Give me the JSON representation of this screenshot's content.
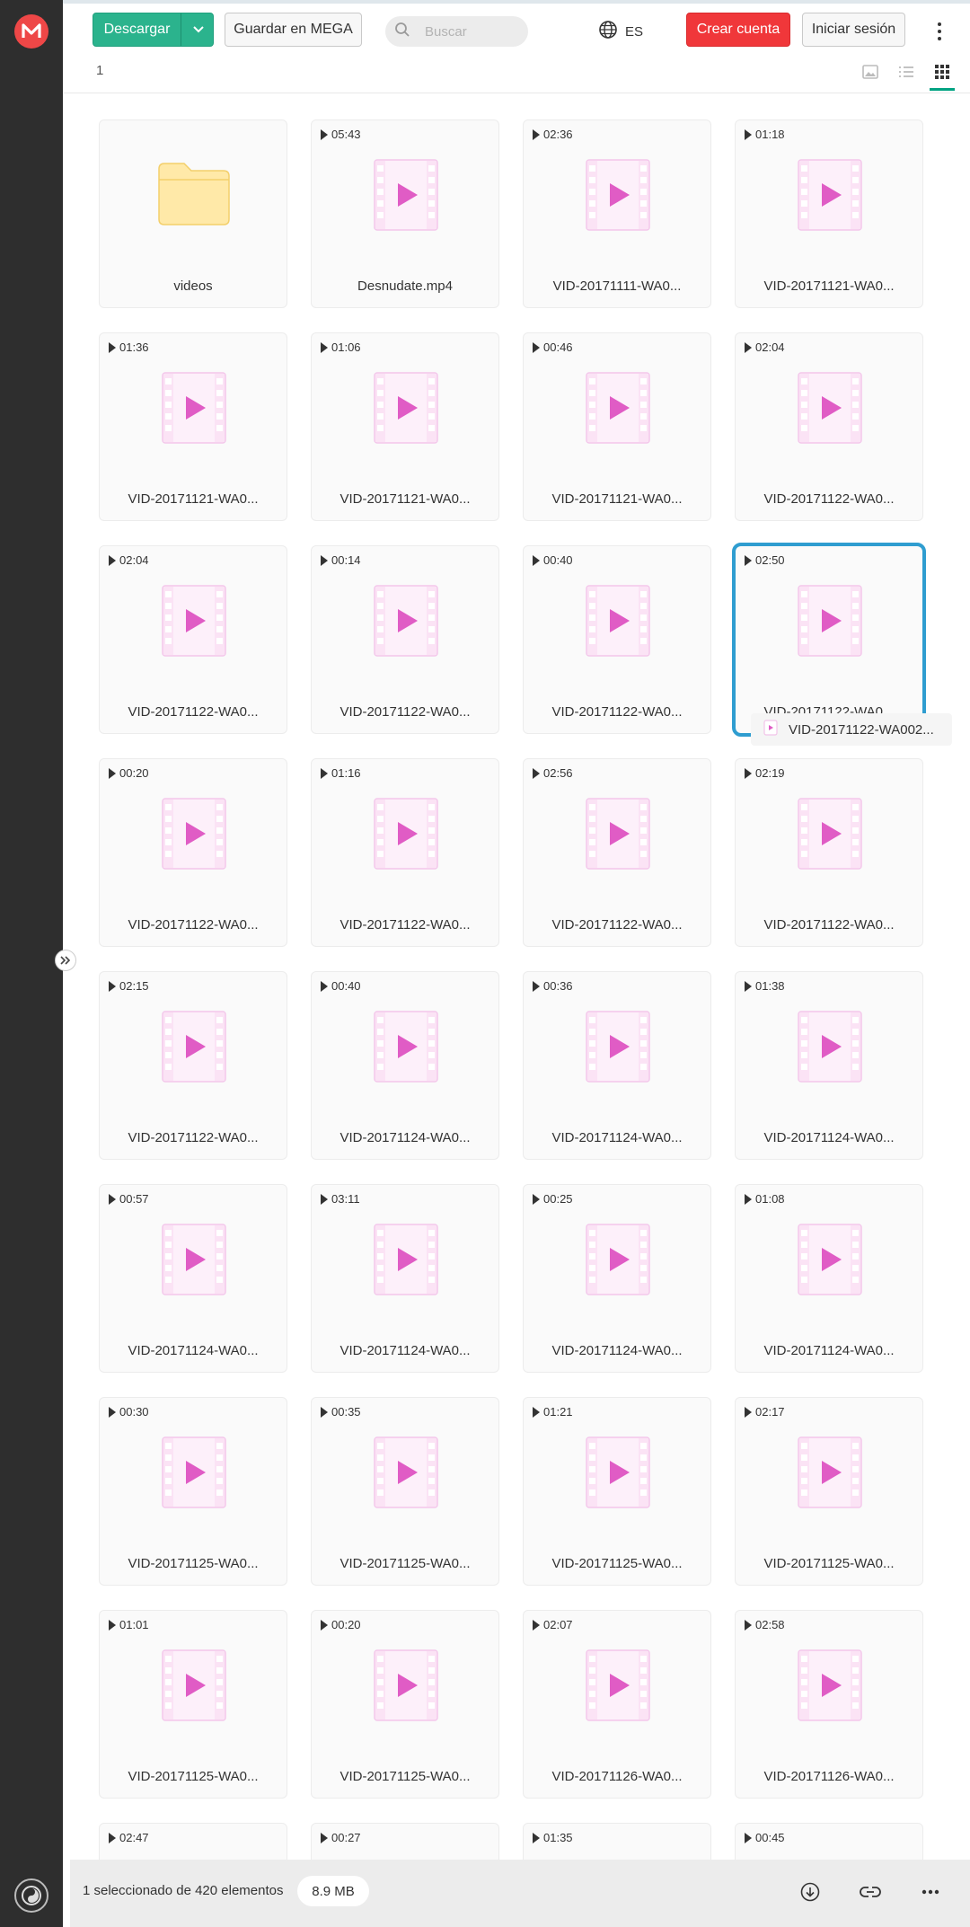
{
  "header": {
    "download_label": "Descargar",
    "save_label": "Guardar en MEGA",
    "search_placeholder": "Buscar",
    "language": "ES",
    "create_account_label": "Crear cuenta",
    "login_label": "Iniciar sesión"
  },
  "breadcrumb": "1",
  "view_mode": "grid",
  "colors": {
    "download": "#2bb38d",
    "create_account": "#f0373a",
    "logo": "#ee4747",
    "selection": "#2f9dd0",
    "video_icon": "#e05cc5"
  },
  "items": [
    {
      "type": "folder",
      "name": "videos"
    },
    {
      "type": "video",
      "duration": "05:43",
      "name": "Desnudate.mp4"
    },
    {
      "type": "video",
      "duration": "02:36",
      "name": "VID-20171111-WA0..."
    },
    {
      "type": "video",
      "duration": "01:18",
      "name": "VID-20171121-WA0..."
    },
    {
      "type": "video",
      "duration": "01:36",
      "name": "VID-20171121-WA0..."
    },
    {
      "type": "video",
      "duration": "01:06",
      "name": "VID-20171121-WA0..."
    },
    {
      "type": "video",
      "duration": "00:46",
      "name": "VID-20171121-WA0..."
    },
    {
      "type": "video",
      "duration": "02:04",
      "name": "VID-20171122-WA0..."
    },
    {
      "type": "video",
      "duration": "02:04",
      "name": "VID-20171122-WA0..."
    },
    {
      "type": "video",
      "duration": "00:14",
      "name": "VID-20171122-WA0..."
    },
    {
      "type": "video",
      "duration": "00:40",
      "name": "VID-20171122-WA0..."
    },
    {
      "type": "video",
      "duration": "02:50",
      "name": "VID-20171122-WA0...",
      "selected": true
    },
    {
      "type": "video",
      "duration": "00:20",
      "name": "VID-20171122-WA0..."
    },
    {
      "type": "video",
      "duration": "01:16",
      "name": "VID-20171122-WA0..."
    },
    {
      "type": "video",
      "duration": "02:56",
      "name": "VID-20171122-WA0..."
    },
    {
      "type": "video",
      "duration": "02:19",
      "name": "VID-20171122-WA0..."
    },
    {
      "type": "video",
      "duration": "02:15",
      "name": "VID-20171122-WA0..."
    },
    {
      "type": "video",
      "duration": "00:40",
      "name": "VID-20171124-WA0..."
    },
    {
      "type": "video",
      "duration": "00:36",
      "name": "VID-20171124-WA0..."
    },
    {
      "type": "video",
      "duration": "01:38",
      "name": "VID-20171124-WA0..."
    },
    {
      "type": "video",
      "duration": "00:57",
      "name": "VID-20171124-WA0..."
    },
    {
      "type": "video",
      "duration": "03:11",
      "name": "VID-20171124-WA0..."
    },
    {
      "type": "video",
      "duration": "00:25",
      "name": "VID-20171124-WA0..."
    },
    {
      "type": "video",
      "duration": "01:08",
      "name": "VID-20171124-WA0..."
    },
    {
      "type": "video",
      "duration": "00:30",
      "name": "VID-20171125-WA0..."
    },
    {
      "type": "video",
      "duration": "00:35",
      "name": "VID-20171125-WA0..."
    },
    {
      "type": "video",
      "duration": "01:21",
      "name": "VID-20171125-WA0..."
    },
    {
      "type": "video",
      "duration": "02:17",
      "name": "VID-20171125-WA0..."
    },
    {
      "type": "video",
      "duration": "01:01",
      "name": "VID-20171125-WA0..."
    },
    {
      "type": "video",
      "duration": "00:20",
      "name": "VID-20171125-WA0..."
    },
    {
      "type": "video",
      "duration": "02:07",
      "name": "VID-20171126-WA0..."
    },
    {
      "type": "video",
      "duration": "02:58",
      "name": "VID-20171126-WA0..."
    },
    {
      "type": "video",
      "duration": "02:47",
      "name": ""
    },
    {
      "type": "video",
      "duration": "00:27",
      "name": ""
    },
    {
      "type": "video",
      "duration": "01:35",
      "name": ""
    },
    {
      "type": "video",
      "duration": "00:45",
      "name": ""
    }
  ],
  "tooltip": "VID-20171122-WA002...",
  "footer": {
    "selection_text": "1 seleccionado de 420 elementos",
    "size": "8.9 MB"
  }
}
